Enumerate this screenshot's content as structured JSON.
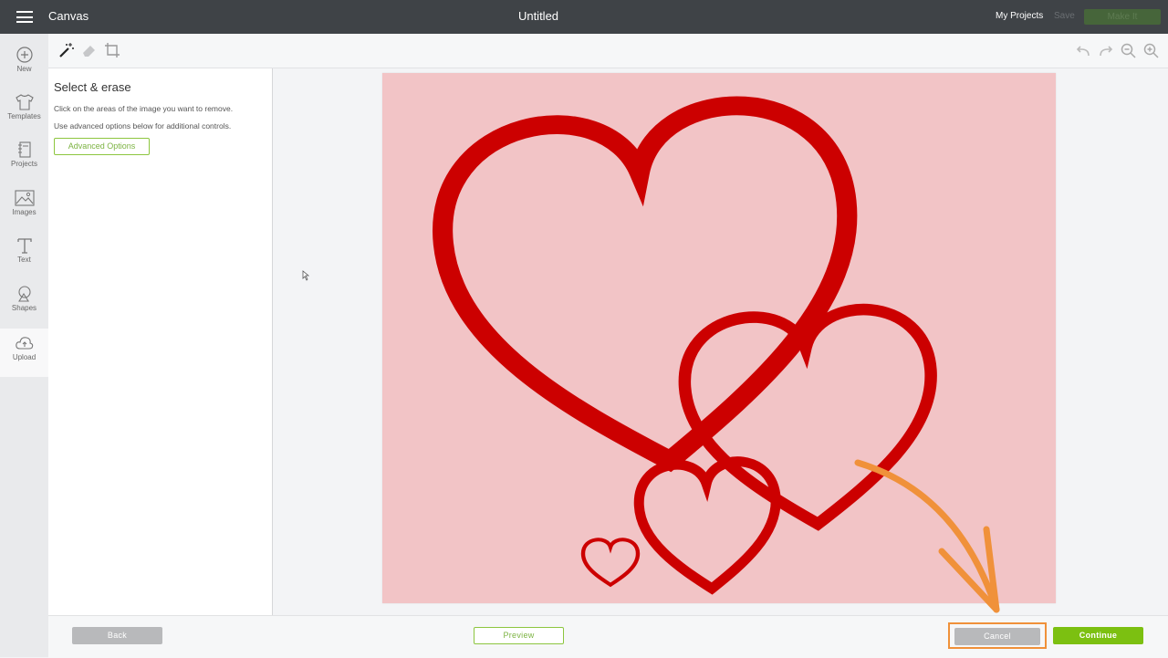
{
  "header": {
    "app_title": "Canvas",
    "doc_title": "Untitled",
    "my_projects": "My Projects",
    "save": "Save",
    "make_it": "Make It"
  },
  "leftnav": {
    "items": [
      {
        "label": "New",
        "icon": "plus-circle-icon"
      },
      {
        "label": "Templates",
        "icon": "tshirt-icon"
      },
      {
        "label": "Projects",
        "icon": "notebook-icon"
      },
      {
        "label": "Images",
        "icon": "image-icon"
      },
      {
        "label": "Text",
        "icon": "text-icon"
      },
      {
        "label": "Shapes",
        "icon": "shapes-icon"
      },
      {
        "label": "Upload",
        "icon": "cloud-upload-icon"
      }
    ],
    "active": "Upload"
  },
  "toolbar": {
    "tools": [
      "magic-wand-icon",
      "eraser-icon",
      "crop-icon"
    ],
    "right_tools": [
      "undo-icon",
      "redo-icon",
      "zoom-out-icon",
      "zoom-in-icon"
    ]
  },
  "panel": {
    "title": "Select & erase",
    "instruction_1": "Click on the areas of the image you want to remove.",
    "instruction_2": "Use advanced options below for additional controls.",
    "advanced_options": "Advanced Options"
  },
  "canvas": {
    "background_color": "#f2c4c6",
    "heart_color": "#cc0000",
    "hearts_count": 4
  },
  "footer": {
    "back": "Back",
    "preview": "Preview",
    "cancel": "Cancel",
    "continue": "Continue"
  },
  "colors": {
    "accent_green": "#7cc011",
    "highlight_orange": "#f0913a",
    "topbar": "#3f4347"
  }
}
